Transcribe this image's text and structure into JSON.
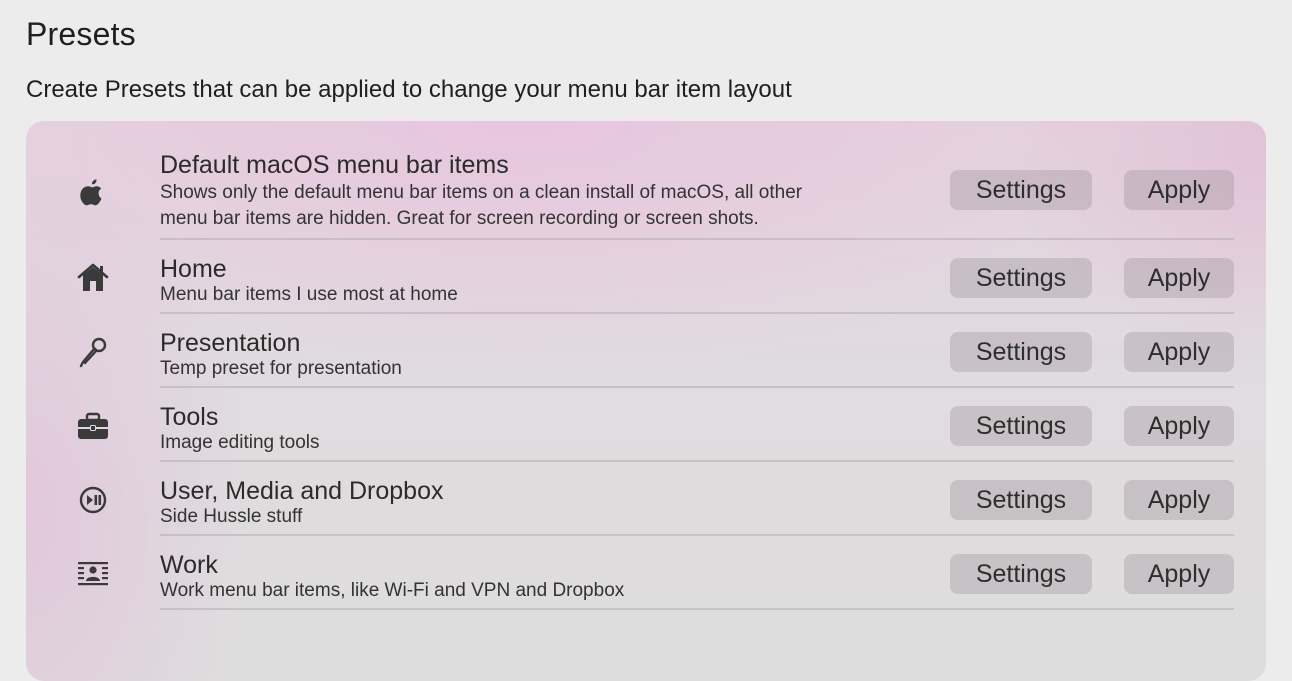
{
  "header": {
    "title": "Presets",
    "subtitle": "Create Presets that can be applied to change your menu bar item layout"
  },
  "presets": [
    {
      "icon": "apple-logo-icon",
      "title": "Default macOS menu bar items",
      "description_line1": "Shows only the default menu bar items on a clean install of macOS, all other",
      "description_line2": "menu bar items are hidden. Great for screen recording or screen shots.",
      "settings_label": "Settings",
      "apply_label": "Apply"
    },
    {
      "icon": "house-icon",
      "title": "Home",
      "description_line1": "Menu bar items I use most at home",
      "settings_label": "Settings",
      "apply_label": "Apply"
    },
    {
      "icon": "microphone-icon",
      "title": "Presentation",
      "description_line1": "Temp preset for presentation",
      "settings_label": "Settings",
      "apply_label": "Apply"
    },
    {
      "icon": "briefcase-icon",
      "title": "Tools",
      "description_line1": "Image editing tools",
      "settings_label": "Settings",
      "apply_label": "Apply"
    },
    {
      "icon": "play-pause-circle-icon",
      "title": "User, Media and Dropbox",
      "description_line1": "Side Hussle stuff",
      "settings_label": "Settings",
      "apply_label": "Apply"
    },
    {
      "icon": "person-text-icon",
      "title": "Work",
      "description_line1": "Work menu bar items, like Wi-Fi and VPN and Dropbox",
      "settings_label": "Settings",
      "apply_label": "Apply"
    }
  ]
}
